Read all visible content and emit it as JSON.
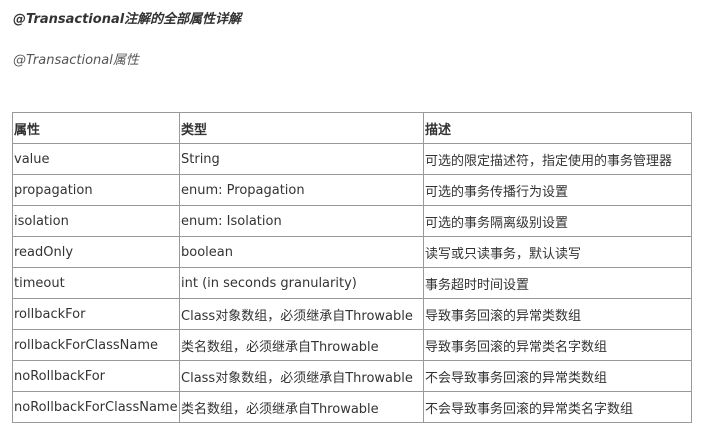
{
  "title": "@Transactional注解的全部属性详解",
  "subtitle": "@Transactional属性",
  "table": {
    "headers": [
      "属性",
      "类型",
      "描述"
    ],
    "rows": [
      [
        "value",
        "String",
        "可选的限定描述符，指定使用的事务管理器"
      ],
      [
        "propagation",
        "enum: Propagation",
        "可选的事务传播行为设置"
      ],
      [
        "isolation",
        "enum: Isolation",
        "可选的事务隔离级别设置"
      ],
      [
        "readOnly",
        "boolean",
        "读写或只读事务，默认读写"
      ],
      [
        "timeout",
        "int (in seconds granularity)",
        "事务超时时间设置"
      ],
      [
        "rollbackFor",
        "Class对象数组，必须继承自Throwable",
        "导致事务回滚的异常类数组"
      ],
      [
        "rollbackForClassName",
        "类名数组，必须继承自Throwable",
        "导致事务回滚的异常类名字数组"
      ],
      [
        "noRollbackFor",
        "Class对象数组，必须继承自Throwable",
        "不会导致事务回滚的异常类数组"
      ],
      [
        "noRollbackForClassName",
        "类名数组，必须继承自Throwable",
        "不会导致事务回滚的异常类名字数组"
      ]
    ]
  }
}
